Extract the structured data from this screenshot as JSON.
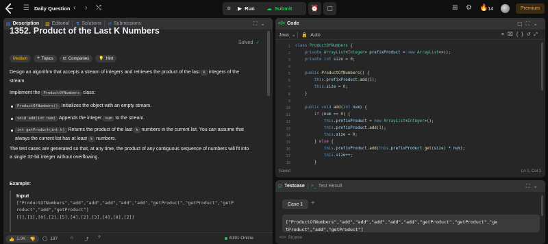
{
  "topbar": {
    "title": "Daily Question",
    "run_label": "Run",
    "submit_label": "Submit",
    "streak_count": "14",
    "premium_label": "Premium",
    "accent": "#ffa116",
    "submit_color": "#2cbb5d"
  },
  "description": {
    "tabs": [
      {
        "label": "Description",
        "icon": "file-icon",
        "active": true
      },
      {
        "label": "Editorial",
        "icon": "book-icon",
        "active": false
      },
      {
        "label": "Solutions",
        "icon": "flask-icon",
        "active": false
      },
      {
        "label": "Submissions",
        "icon": "history-icon",
        "active": false
      }
    ],
    "title": "1352. Product of the Last K Numbers",
    "status": "Solved",
    "tags": [
      "Medium",
      "Topics",
      "Companies",
      "Hint"
    ],
    "p1a": "Design an algorithm that accepts a stream of integers and retrieves the product of the last",
    "p1k": "k",
    "p1b": "integers of the",
    "p1c": "stream.",
    "p2a": "Implement the",
    "p2code": "ProductOfNumbers",
    "p2b": "class:",
    "b1code": "ProductOfNumbers()",
    "b1text": "Initializes the object with an empty stream.",
    "b2code": "void add(int num)",
    "b2a": "Appends the integer",
    "b2code2": "num",
    "b2b": "to the stream.",
    "b3code": "int getProduct(int k)",
    "b3a": "Returns the product of the last",
    "b3k": "k",
    "b3b": "numbers in the current list. You can assume that",
    "b3c": "always the current list has at least",
    "b3k2": "k",
    "b3d": "numbers.",
    "p3a": "The test cases are generated so that, at any time, the product of any contiguous sequence of numbers will fit into",
    "p3b": "a single 32-bit integer without overflowing.",
    "example_heading": "Example:",
    "input_label": "Input",
    "input_line1": "[\"ProductOfNumbers\",\"add\",\"add\",\"add\",\"add\",\"add\",\"getProduct\",\"getProduct\",\"getP",
    "input_line2": "roduct\",\"add\",\"getProduct\"]",
    "input_line3": "[[],[3],[0],[2],[5],[4],[2],[3],[4],[8],[2]]",
    "footer": {
      "likes": "1.9K",
      "comments": "197",
      "online": "6191 Online"
    }
  },
  "code": {
    "tab_label": "Code",
    "language": "Java",
    "mode": "Auto",
    "status": "Saved",
    "cursor": "Ln 1, Col 1",
    "line_numbers": [
      "1",
      "2",
      "3",
      "4",
      "5",
      "6",
      "7",
      "8",
      "9",
      "10",
      "11",
      "12",
      "13",
      "14",
      "15",
      "16",
      "17",
      "18"
    ]
  },
  "testcase": {
    "tab_label": "Testcase",
    "result_label": "Test Result",
    "case_label": "Case 1",
    "input_line1": "[\"ProductOfNumbers\",\"add\",\"add\",\"add\",\"add\",\"add\",\"getProduct\",\"getProduct\",\"ge",
    "input_line2": "tProduct\",\"add\",\"getProduct\"]",
    "source_label": "Source"
  }
}
